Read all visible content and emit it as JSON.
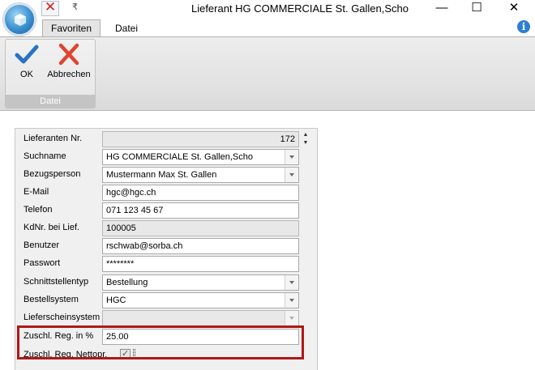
{
  "window": {
    "title": "Lieferant HG COMMERCIALE St. Gallen,Scho",
    "minimize": "—",
    "maximize": "☐",
    "close": "✕"
  },
  "qat": {
    "close_glyph": "✕",
    "dropdown_glyph": "₹"
  },
  "ribbon": {
    "tabs": [
      {
        "label": "Favoriten",
        "active": true
      },
      {
        "label": "Datei",
        "active": false
      }
    ],
    "info_glyph": "i",
    "group_label": "Datei",
    "ok_label": "OK",
    "cancel_label": "Abbrechen"
  },
  "form": {
    "lieferanten_nr": {
      "label": "Lieferanten Nr.",
      "value": "172"
    },
    "suchname": {
      "label": "Suchname",
      "value": "HG COMMERCIALE St. Gallen,Scho"
    },
    "bezugsperson": {
      "label": "Bezugsperson",
      "value": "Mustermann Max St. Gallen"
    },
    "email": {
      "label": "E-Mail",
      "value": "hgc@hgc.ch"
    },
    "telefon": {
      "label": "Telefon",
      "value": "071 123 45 67"
    },
    "kdnr": {
      "label": "KdNr. bei Lief.",
      "value": "100005"
    },
    "benutzer": {
      "label": "Benutzer",
      "value": "rschwab@sorba.ch"
    },
    "passwort": {
      "label": "Passwort",
      "value": "********"
    },
    "schnittstellentyp": {
      "label": "Schnittstellentyp",
      "value": "Bestellung"
    },
    "bestellsystem": {
      "label": "Bestellsystem",
      "value": "HGC"
    },
    "lieferscheinsystem": {
      "label": "Lieferscheinsystem",
      "value": ""
    },
    "zuschl_reg": {
      "label": "Zuschl. Reg. in %",
      "value": "25.00"
    },
    "zuschl_netto": {
      "label": "Zuschl. Reg. Nettopr.",
      "checked": true,
      "check_glyph": "✓"
    }
  },
  "colors": {
    "highlight": "#b01818",
    "accent": "#2d7fd3",
    "close_red": "#d22323"
  }
}
